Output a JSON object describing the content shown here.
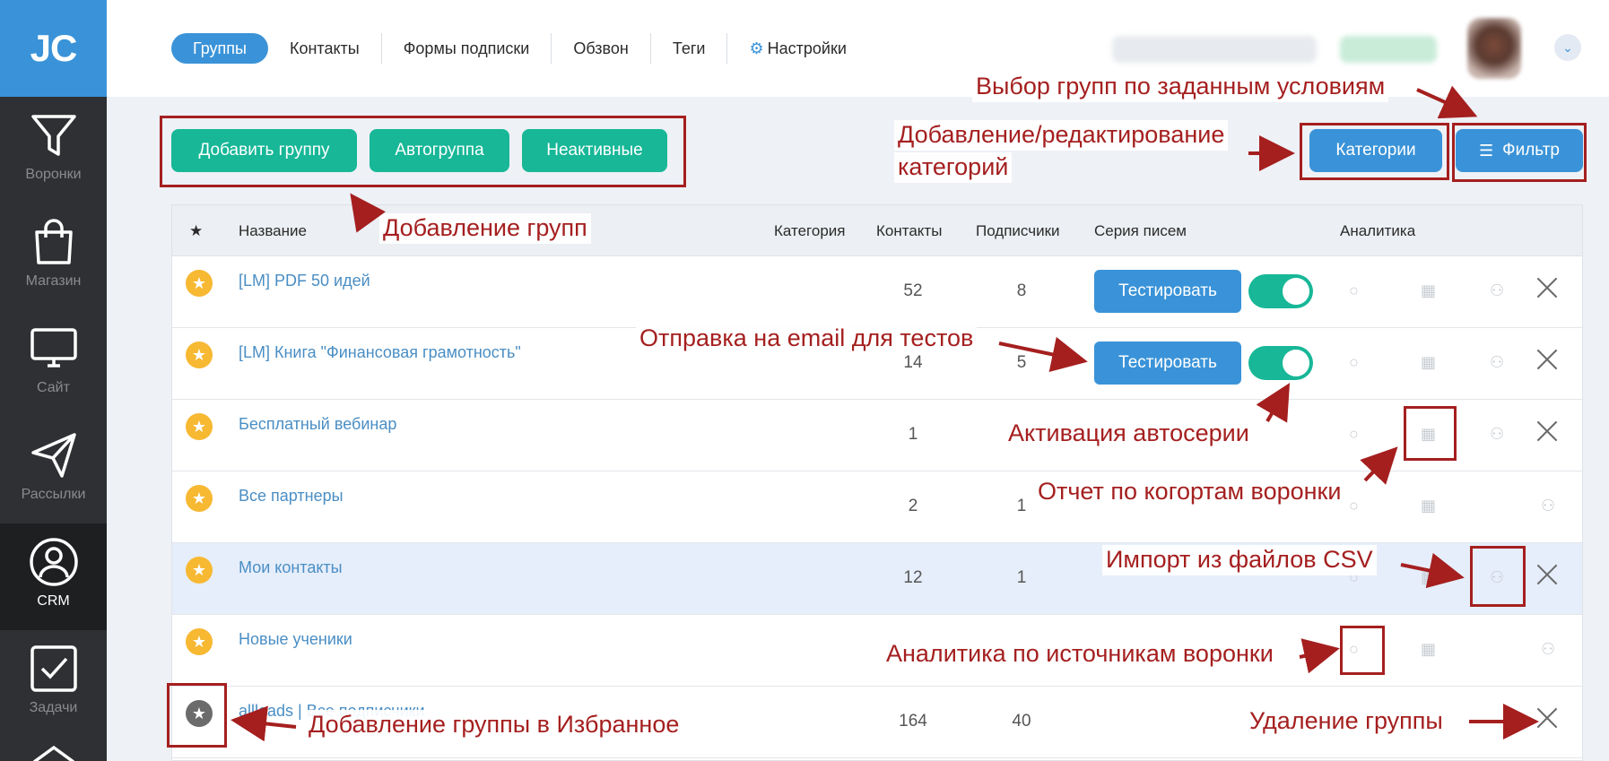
{
  "sidebar": {
    "logo": "JC",
    "items": [
      {
        "label": "Воронки",
        "icon": "funnel-icon"
      },
      {
        "label": "Магазин",
        "icon": "shopping-bag-icon"
      },
      {
        "label": "Сайт",
        "icon": "monitor-icon"
      },
      {
        "label": "Рассылки",
        "icon": "paper-plane-icon"
      },
      {
        "label": "CRM",
        "icon": "user-circle-icon",
        "active": true
      },
      {
        "label": "Задачи",
        "icon": "checkbox-icon"
      }
    ]
  },
  "nav": {
    "tabs": [
      "Группы",
      "Контакты",
      "Формы подписки",
      "Обзвон",
      "Теги",
      "Настройки"
    ],
    "active": "Группы"
  },
  "toolbar": {
    "add_group": "Добавить группу",
    "autogroup": "Автогруппа",
    "inactive": "Неактивные",
    "categories": "Категории",
    "filter": "Фильтр"
  },
  "table": {
    "headers": {
      "star": "★",
      "name": "Название",
      "category": "Категория",
      "contacts": "Контакты",
      "subscribers": "Подписчики",
      "series": "Серия писем",
      "analytics": "Аналитика"
    },
    "test_label": "Тестировать",
    "rows": [
      {
        "name": "[LM] PDF 50 идей",
        "contacts": "52",
        "subscribers": "8"
      },
      {
        "name": "[LM] Книга \"Финансовая грамотность\"",
        "contacts": "14",
        "subscribers": "5"
      },
      {
        "name": "Бесплатный вебинар",
        "contacts": "1",
        "subscribers": ""
      },
      {
        "name": "Все партнеры",
        "contacts": "2",
        "subscribers": "1"
      },
      {
        "name": "Мои контакты",
        "contacts": "12",
        "subscribers": "1"
      },
      {
        "name": "Новые ученики",
        "contacts": "",
        "subscribers": ""
      },
      {
        "name": "allleads | Все подписчики",
        "contacts": "164",
        "subscribers": "40"
      }
    ]
  },
  "annotations": {
    "filter_note": "Выбор групп по заданным условиям",
    "categories_note_1": "Добавление/редактирование",
    "categories_note_2": "категорий",
    "add_groups_note": "Добавление групп",
    "test_note": "Отправка на email для тестов",
    "activation_note": "Активация автосерии",
    "cohort_note": "Отчет по когортам воронки",
    "import_note": "Импорт из файлов CSV",
    "analytics_note": "Аналитика по источникам воронки",
    "favorite_note": "Добавление группы в Избранное",
    "delete_note": "Удаление группы"
  },
  "colors": {
    "sidebar": "#2f3033",
    "brand_blue": "#3a93d8",
    "green": "#17b797",
    "annotation_red": "#a51f1f",
    "star_yellow": "#f7b832"
  }
}
